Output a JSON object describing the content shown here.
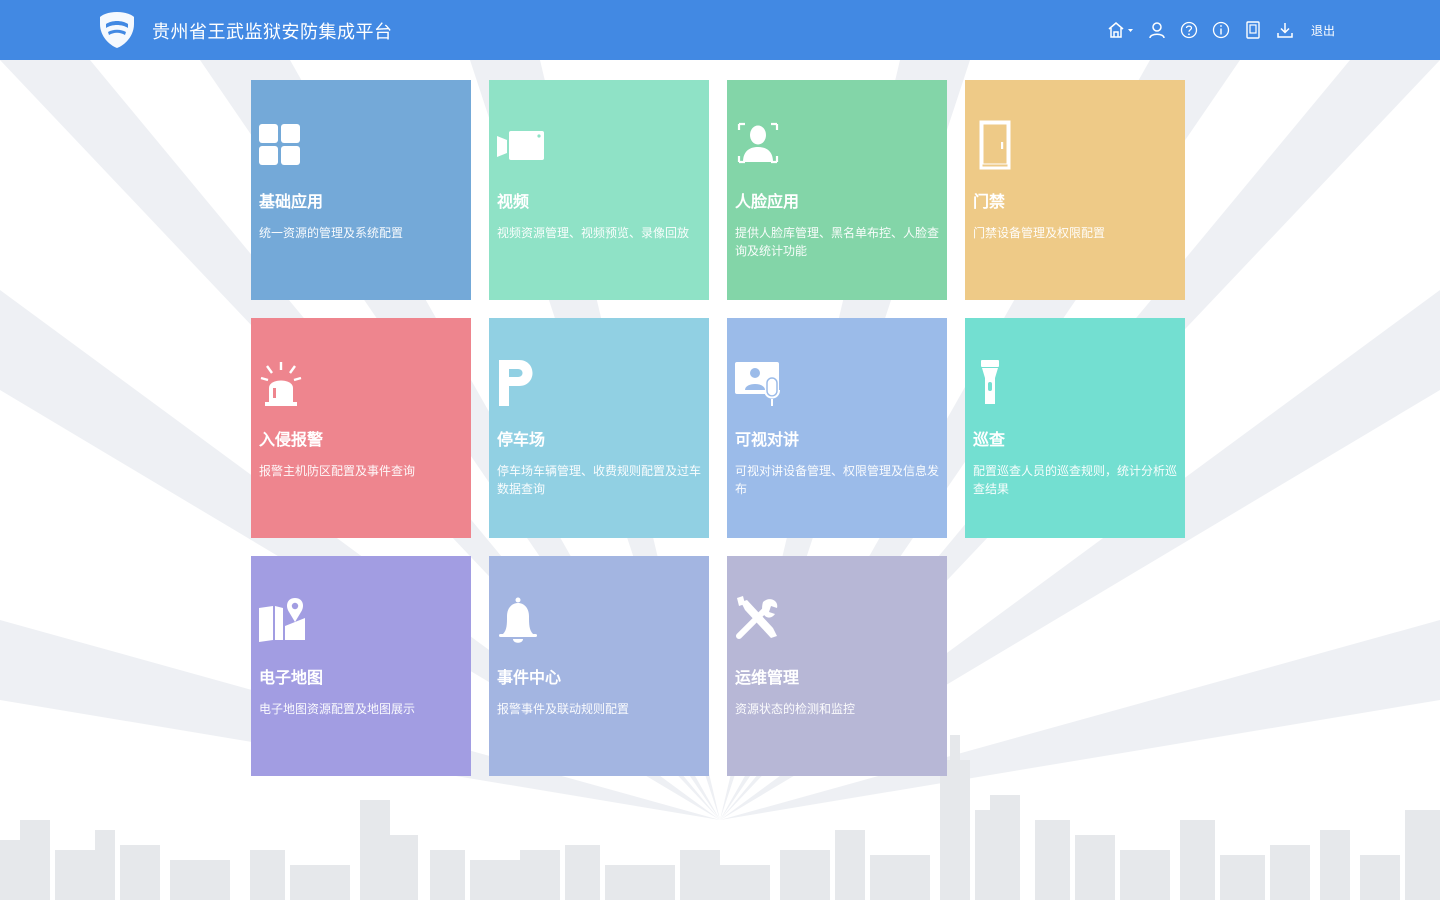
{
  "header": {
    "title": "贵州省王武监狱安防集成平台",
    "bg_color": "#4289e3",
    "logout_label": "退出",
    "icons": [
      "home-icon",
      "user-icon",
      "help-icon",
      "info-icon",
      "book-icon",
      "download-icon"
    ]
  },
  "tiles": [
    {
      "title": "基础应用",
      "desc": "统一资源的管理及系统配置",
      "color": "#74a9d8",
      "icon": "grid-icon"
    },
    {
      "title": "视频",
      "desc": "视频资源管理、视频预览、录像回放",
      "color": "#8fe2c6",
      "icon": "video-camera-icon"
    },
    {
      "title": "人脸应用",
      "desc": "提供人脸库管理、黑名单布控、人脸查询及统计功能",
      "color": "#83d5a8",
      "icon": "face-recognition-icon"
    },
    {
      "title": "门禁",
      "desc": "门禁设备管理及权限配置",
      "color": "#eeca87",
      "icon": "door-icon"
    },
    {
      "title": "入侵报警",
      "desc": "报警主机防区配置及事件查询",
      "color": "#ee858e",
      "icon": "alarm-light-icon"
    },
    {
      "title": "停车场",
      "desc": "停车场车辆管理、收费规则配置及过车数据查询",
      "color": "#91d0e3",
      "icon": "parking-icon"
    },
    {
      "title": "可视对讲",
      "desc": "可视对讲设备管理、权限管理及信息发布",
      "color": "#9bbbe9",
      "icon": "intercom-icon"
    },
    {
      "title": "巡查",
      "desc": "配置巡查人员的巡查规则，统计分析巡查结果",
      "color": "#73dfd1",
      "icon": "flashlight-icon"
    },
    {
      "title": "电子地图",
      "desc": "电子地图资源配置及地图展示",
      "color": "#a29de2",
      "icon": "map-icon"
    },
    {
      "title": "事件中心",
      "desc": "报警事件及联动规则配置",
      "color": "#a3b5e1",
      "icon": "bell-icon"
    },
    {
      "title": "运维管理",
      "desc": "资源状态的检测和监控",
      "color": "#b7b7d6",
      "icon": "tools-icon"
    }
  ]
}
